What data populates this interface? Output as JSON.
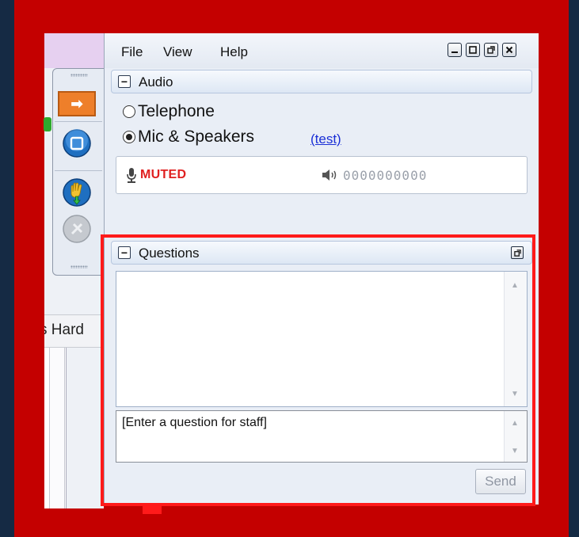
{
  "background_app": {
    "tab_label_fragment": "s Hard"
  },
  "menu": {
    "file": "File",
    "view": "View",
    "help": "Help"
  },
  "window_buttons": [
    "minimize",
    "restore",
    "popout",
    "close"
  ],
  "audio": {
    "title": "Audio",
    "options": [
      {
        "label": "Telephone",
        "selected": false
      },
      {
        "label": "Mic & Speakers",
        "selected": true
      }
    ],
    "test_link": "(test)",
    "status": "MUTED",
    "meter": "0000000000"
  },
  "questions": {
    "title": "Questions",
    "input_placeholder": "[Enter a question for staff]",
    "send_label": "Send"
  },
  "colors": {
    "frame": "#c40000",
    "highlight": "#ff1a1a",
    "muted_text": "#e02020",
    "link": "#1a2fd6",
    "toolbar_accent": "#ee7f2a"
  }
}
